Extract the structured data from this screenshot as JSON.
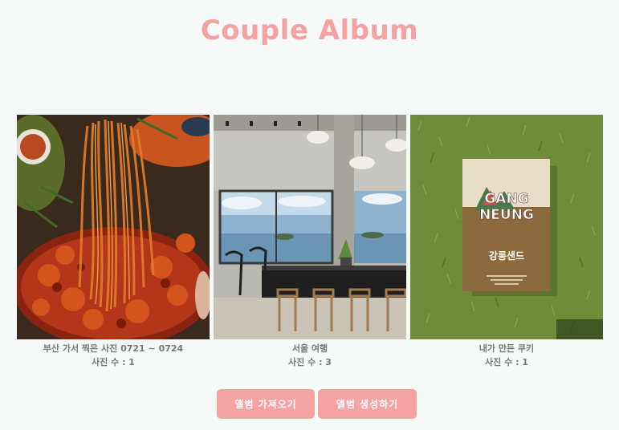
{
  "header": {
    "title": "Couple Album"
  },
  "albums": [
    {
      "name": "부산 가서 찍은 사진 0721 ~ 0724",
      "count_label": "사진 수 : 1",
      "thumbnail": "food-photo"
    },
    {
      "name": "서울 여행",
      "count_label": "사진 수 : 3",
      "thumbnail": "cafe-photo"
    },
    {
      "name": "내가 만든 쿠키",
      "count_label": "사진 수 : 1",
      "thumbnail": "cookie-box-photo",
      "box_text": {
        "brand_line1": "GANG",
        "brand_line2": "NEUNG",
        "korean": "강릉샌드"
      }
    }
  ],
  "actions": {
    "import_label": "앨범 가져오기",
    "create_label": "앨범 생성하기"
  },
  "colors": {
    "accent": "#f4a3a3",
    "background": "#f5f9f7",
    "caption": "#777777"
  }
}
